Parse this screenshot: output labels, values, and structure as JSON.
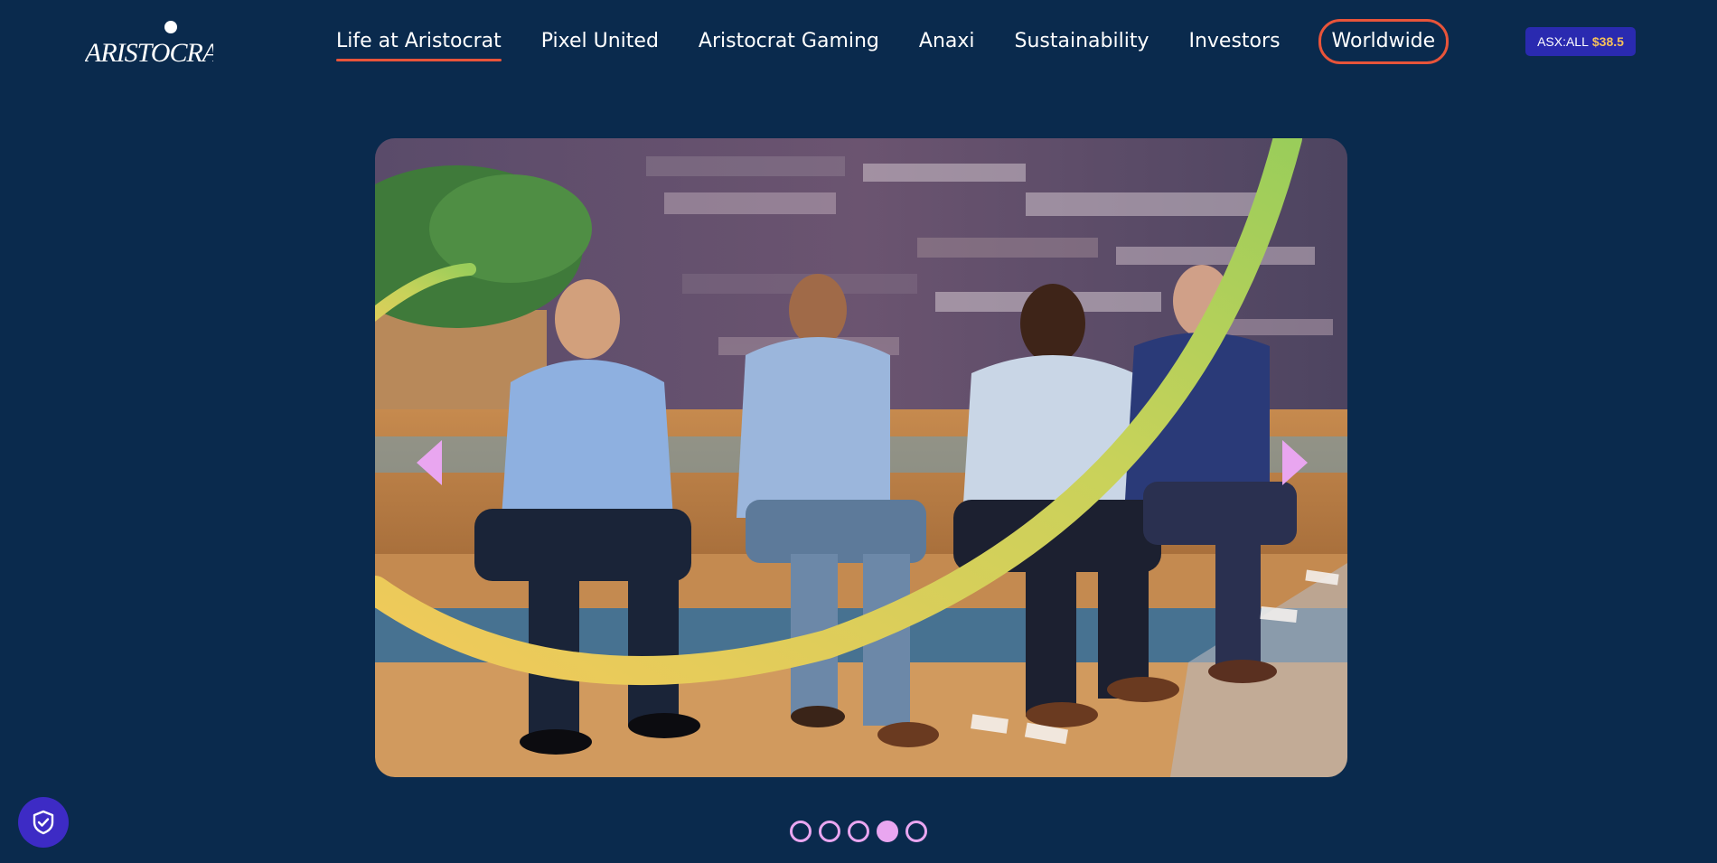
{
  "header": {
    "logo_alt": "Aristocrat",
    "nav": [
      {
        "label": "Life at Aristocrat",
        "active": true
      },
      {
        "label": "Pixel United",
        "active": false
      },
      {
        "label": "Aristocrat Gaming",
        "active": false
      },
      {
        "label": "Anaxi",
        "active": false
      },
      {
        "label": "Sustainability",
        "active": false
      },
      {
        "label": "Investors",
        "active": false
      },
      {
        "label": "Worldwide",
        "active": false,
        "boxed": true
      }
    ],
    "ticker": {
      "symbol": "ASX:ALL",
      "price": "$38.5"
    }
  },
  "carousel": {
    "slide_count": 5,
    "active_slide_index": 3,
    "prev_icon": "triangle-left-icon",
    "next_icon": "triangle-right-icon"
  },
  "privacy": {
    "icon": "shield-check-icon"
  },
  "colors": {
    "background": "#0a2a4d",
    "accent_red": "#e8543a",
    "accent_pink": "#e9a6f0",
    "ticker_bg": "#2a2ab0",
    "ticker_price": "#f6c15a",
    "privacy_bg": "#3d2bc5",
    "arc_green": "#9acd5a",
    "arc_yellow": "#f2c95a"
  }
}
